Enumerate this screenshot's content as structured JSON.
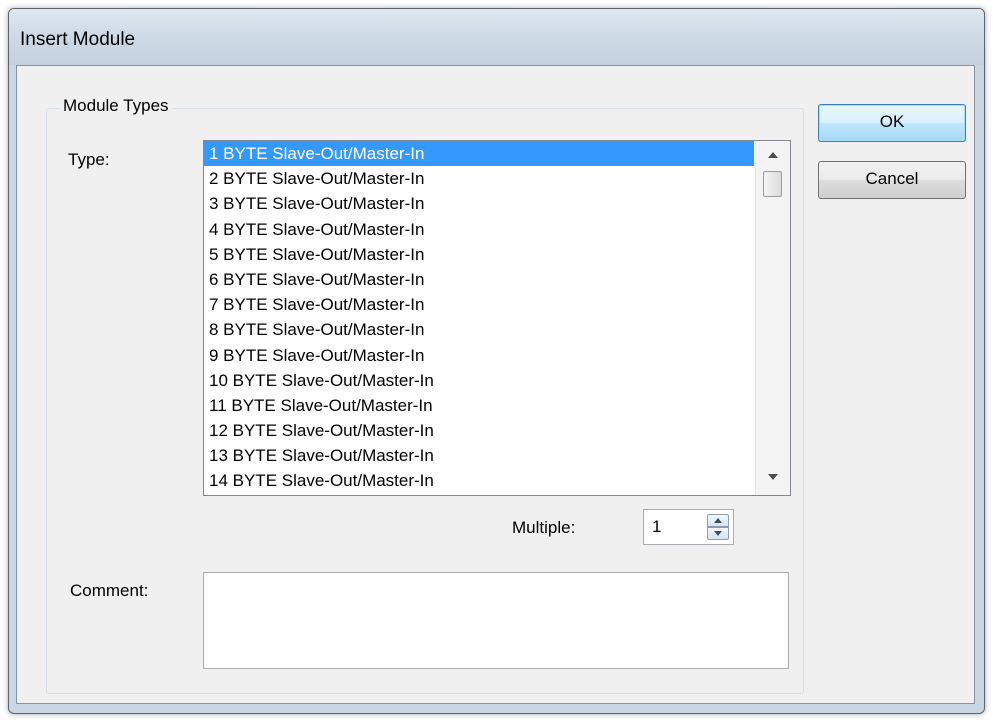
{
  "window": {
    "title": "Insert Module"
  },
  "group": {
    "label": "Module Types"
  },
  "type_field": {
    "label": "Type:",
    "items": [
      "1 BYTE Slave-Out/Master-In",
      "2 BYTE Slave-Out/Master-In",
      "3 BYTE Slave-Out/Master-In",
      "4 BYTE Slave-Out/Master-In",
      "5 BYTE Slave-Out/Master-In",
      "6 BYTE Slave-Out/Master-In",
      "7 BYTE Slave-Out/Master-In",
      "8 BYTE Slave-Out/Master-In",
      "9 BYTE Slave-Out/Master-In",
      "10 BYTE Slave-Out/Master-In",
      "11 BYTE Slave-Out/Master-In",
      "12 BYTE Slave-Out/Master-In",
      "13 BYTE Slave-Out/Master-In",
      "14 BYTE Slave-Out/Master-In"
    ],
    "selected_index": 0
  },
  "multiple": {
    "label": "Multiple:",
    "value": "1"
  },
  "comment": {
    "label": "Comment:",
    "value": ""
  },
  "buttons": {
    "ok": "OK",
    "cancel": "Cancel"
  },
  "colors": {
    "selection": "#3399ff",
    "default_button": "#bee6fd",
    "titlebar": "#cdd9e5"
  },
  "icons": {
    "scroll_up": "scroll-up-arrow-icon",
    "scroll_down": "scroll-down-arrow-icon",
    "spin_up": "spin-up-arrow-icon",
    "spin_down": "spin-down-arrow-icon"
  }
}
